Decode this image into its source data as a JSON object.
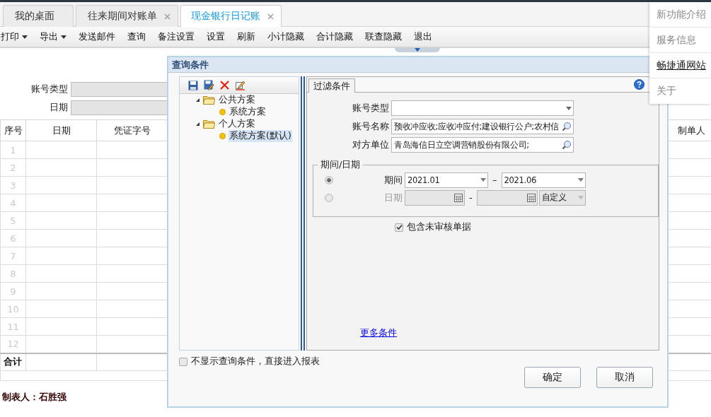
{
  "tabs": [
    {
      "label": "我的桌面",
      "closable": false,
      "selected": false
    },
    {
      "label": "往来期间对账单",
      "closable": true,
      "selected": false
    },
    {
      "label": "现金银行日记账",
      "closable": true,
      "selected": true
    }
  ],
  "toolbar": [
    {
      "label": "打印",
      "dropdown": true
    },
    {
      "label": "导出",
      "dropdown": true
    },
    {
      "label": "发送邮件",
      "dropdown": false
    },
    {
      "label": "查询",
      "dropdown": false
    },
    {
      "label": "备注设置",
      "dropdown": false
    },
    {
      "label": "设置",
      "dropdown": false
    },
    {
      "label": "刷新",
      "dropdown": false
    },
    {
      "label": "小计隐藏",
      "dropdown": false
    },
    {
      "label": "合计隐藏",
      "dropdown": false
    },
    {
      "label": "联查隐藏",
      "dropdown": false
    },
    {
      "label": "退出",
      "dropdown": false
    }
  ],
  "report": {
    "filters": [
      "账号类型",
      "日期"
    ],
    "columns": [
      "序号",
      "日期",
      "凭证字号",
      "制单人"
    ],
    "row_numbers": [
      "1",
      "2",
      "3",
      "4",
      "5",
      "6",
      "7",
      "8",
      "9",
      "10",
      "11",
      "12"
    ],
    "total_label": "合计",
    "maker": "制表人：石胜强"
  },
  "dialog": {
    "title": "查询条件",
    "schemes": [
      {
        "label": "公共方案",
        "expanded": true,
        "children": [
          {
            "label": "系统方案",
            "selected": false
          }
        ]
      },
      {
        "label": "个人方案",
        "expanded": true,
        "children": [
          {
            "label": "系统方案(默认)",
            "selected": true
          }
        ]
      }
    ],
    "tab": "过滤条件",
    "fields": [
      {
        "label": "账号类型",
        "kind": "select"
      },
      {
        "label": "账号名称",
        "kind": "lookup",
        "value": "预收冲应收;应收冲应付;建设银行公户;农村信"
      },
      {
        "label": "对方单位",
        "kind": "lookup",
        "value": "青岛海信日立空调营销股份有限公司;"
      }
    ],
    "period": {
      "title": "期间/日期",
      "options": [
        {
          "kind": "period",
          "label": "期间",
          "selected": true,
          "from": "2021.01",
          "separator": "–",
          "to": "2021.06"
        },
        {
          "kind": "date",
          "label": "日期",
          "selected": false,
          "separator": "-",
          "range_type": "自定义"
        }
      ]
    },
    "include_unaudited": {
      "label": "包含未审核单据",
      "checked": true
    },
    "more_link": "更多条件",
    "skip_dialog": {
      "label": "不显示查询条件，直接进入报表",
      "checked": false
    },
    "buttons": [
      "确定",
      "取消"
    ]
  },
  "menu": [
    {
      "label": "新功能介绍",
      "kind": "plain"
    },
    {
      "label": "服务信息",
      "kind": "plain"
    },
    {
      "label": "畅捷通网站",
      "kind": "link"
    },
    {
      "label": "关于",
      "kind": "plain"
    }
  ]
}
